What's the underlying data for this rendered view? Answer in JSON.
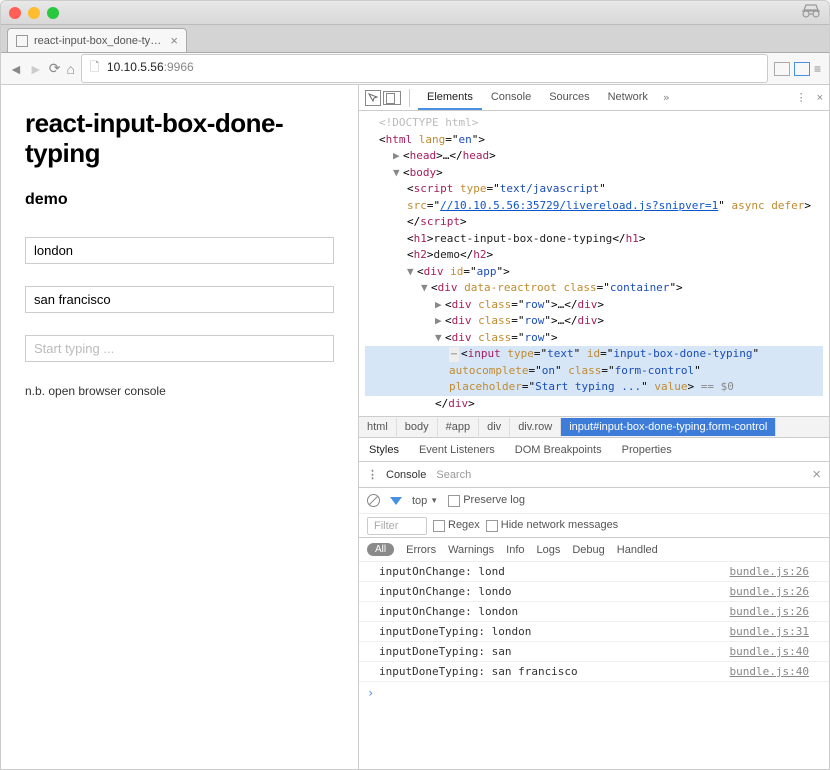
{
  "browser": {
    "tab_title": "react-input-box_done-typin…",
    "url_host": "10.10.5.56",
    "url_port": ":9966"
  },
  "page": {
    "h1": "react-input-box-done-typing",
    "h2": "demo",
    "input1": "london",
    "input2": "san francisco",
    "input3_placeholder": "Start typing ...",
    "note": "n.b. open browser console"
  },
  "devtools": {
    "tabs": [
      "Elements",
      "Console",
      "Sources",
      "Network"
    ],
    "crumbs": [
      "html",
      "body",
      "#app",
      "div",
      "div.row",
      "input#input-box-done-typing.form-control"
    ],
    "subtabs": [
      "Styles",
      "Event Listeners",
      "DOM Breakpoints",
      "Properties"
    ],
    "console_label": "Console",
    "console_search": "Search",
    "scope": "top",
    "preserve": "Preserve log",
    "filter_placeholder": "Filter",
    "regex": "Regex",
    "hide_net": "Hide network messages",
    "pill": "All",
    "levels": [
      "Errors",
      "Warnings",
      "Info",
      "Logs",
      "Debug",
      "Handled"
    ],
    "logs": [
      {
        "msg": "inputOnChange: lond",
        "src": "bundle.js:26"
      },
      {
        "msg": "inputOnChange: londo",
        "src": "bundle.js:26"
      },
      {
        "msg": "inputOnChange: london",
        "src": "bundle.js:26"
      },
      {
        "msg": "inputDoneTyping: london",
        "src": "bundle.js:31"
      },
      {
        "msg": "inputDoneTyping: san",
        "src": "bundle.js:40"
      },
      {
        "msg": "inputDoneTyping: san francisco",
        "src": "bundle.js:40"
      }
    ],
    "dom": {
      "doctype": "<!DOCTYPE html>",
      "lang": "en",
      "script_src": "//10.10.5.56:35729/livereload.js?snipver=1",
      "h1_text": "react-input-box-done-typing",
      "h2_text": "demo",
      "app_id": "app",
      "container": "container",
      "row": "row",
      "input_type": "text",
      "input_id": "input-box-done-typing",
      "autocomplete": "on",
      "input_class": "form-control",
      "placeholder": "Start typing ...",
      "value": "value",
      "eq": " == $0"
    }
  }
}
